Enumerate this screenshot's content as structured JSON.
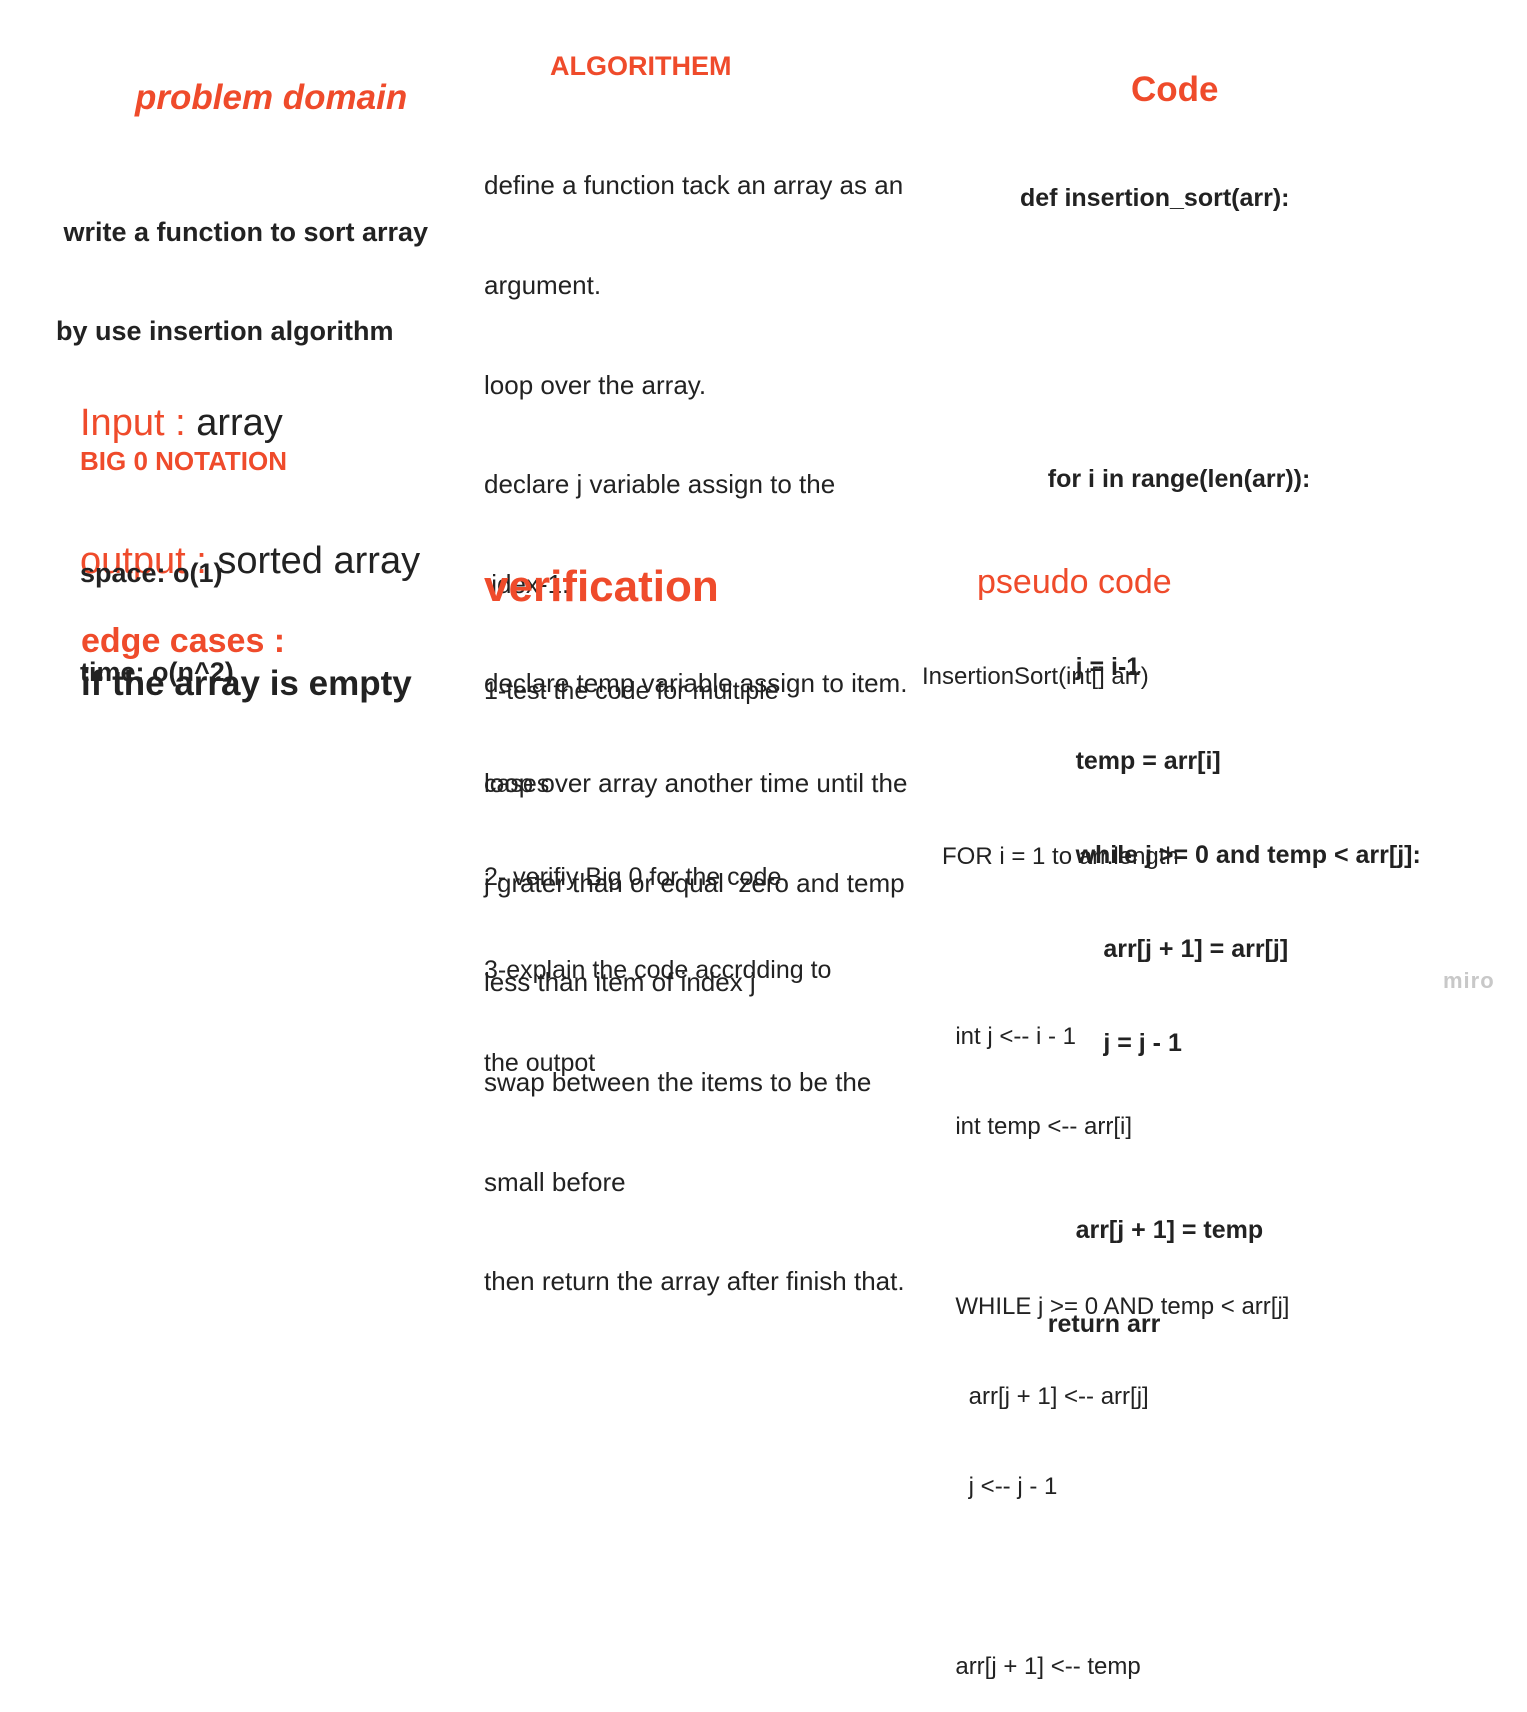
{
  "problem_domain": {
    "title": "problem domain",
    "lines": [
      " write a function to sort array",
      "by use insertion algorithm"
    ]
  },
  "io": {
    "input_label": "Input : ",
    "input_value": "array",
    "output_label": "output : ",
    "output_value": "sorted array"
  },
  "big_o": {
    "title": "BIG 0 NOTATION",
    "lines": [
      "space: o(1)",
      "time: o(n^2)"
    ]
  },
  "edge_cases": {
    "title": "edge cases :",
    "text": "if the array is empty"
  },
  "algorithm": {
    "title": "ALGORITHEM",
    "lines": [
      "define a function tack an array as an",
      "argument.",
      "loop over the array.",
      "declare j variable assign to the",
      " idex-1.",
      "declare temp variable assign to item.",
      "loop over array another time until the",
      "j grater than or equal  zero and temp",
      "less than item of index j",
      "swap between the items to be the",
      "small before",
      "then return the array after finish that."
    ]
  },
  "verification": {
    "title": "verification",
    "lines": [
      "1-test the code for multiple",
      "cases",
      "2- verifiy Big 0 for the code",
      "3-explain the code accrdding to",
      "the outpot"
    ]
  },
  "code": {
    "title": "Code",
    "lines": [
      "def insertion_sort(arr):",
      "",
      "",
      "    for i in range(len(arr)):",
      "",
      "        j = i-1",
      "        temp = arr[i]",
      "        while j >= 0 and temp < arr[j]:",
      "            arr[j + 1] = arr[j]",
      "            j = j - 1",
      "",
      "        arr[j + 1] = temp",
      "    return arr"
    ]
  },
  "pseudo_code": {
    "title": "pseudo code",
    "lines": [
      "InsertionSort(int[] arr)",
      "",
      "   FOR i = 1 to arr.length",
      "",
      "     int j <-- i - 1",
      "     int temp <-- arr[i]",
      "",
      "     WHILE j >= 0 AND temp < arr[j]",
      "       arr[j + 1] <-- arr[j]",
      "       j <-- j - 1",
      "",
      "     arr[j + 1] <-- temp"
    ]
  },
  "branding": {
    "logo": "miro"
  }
}
